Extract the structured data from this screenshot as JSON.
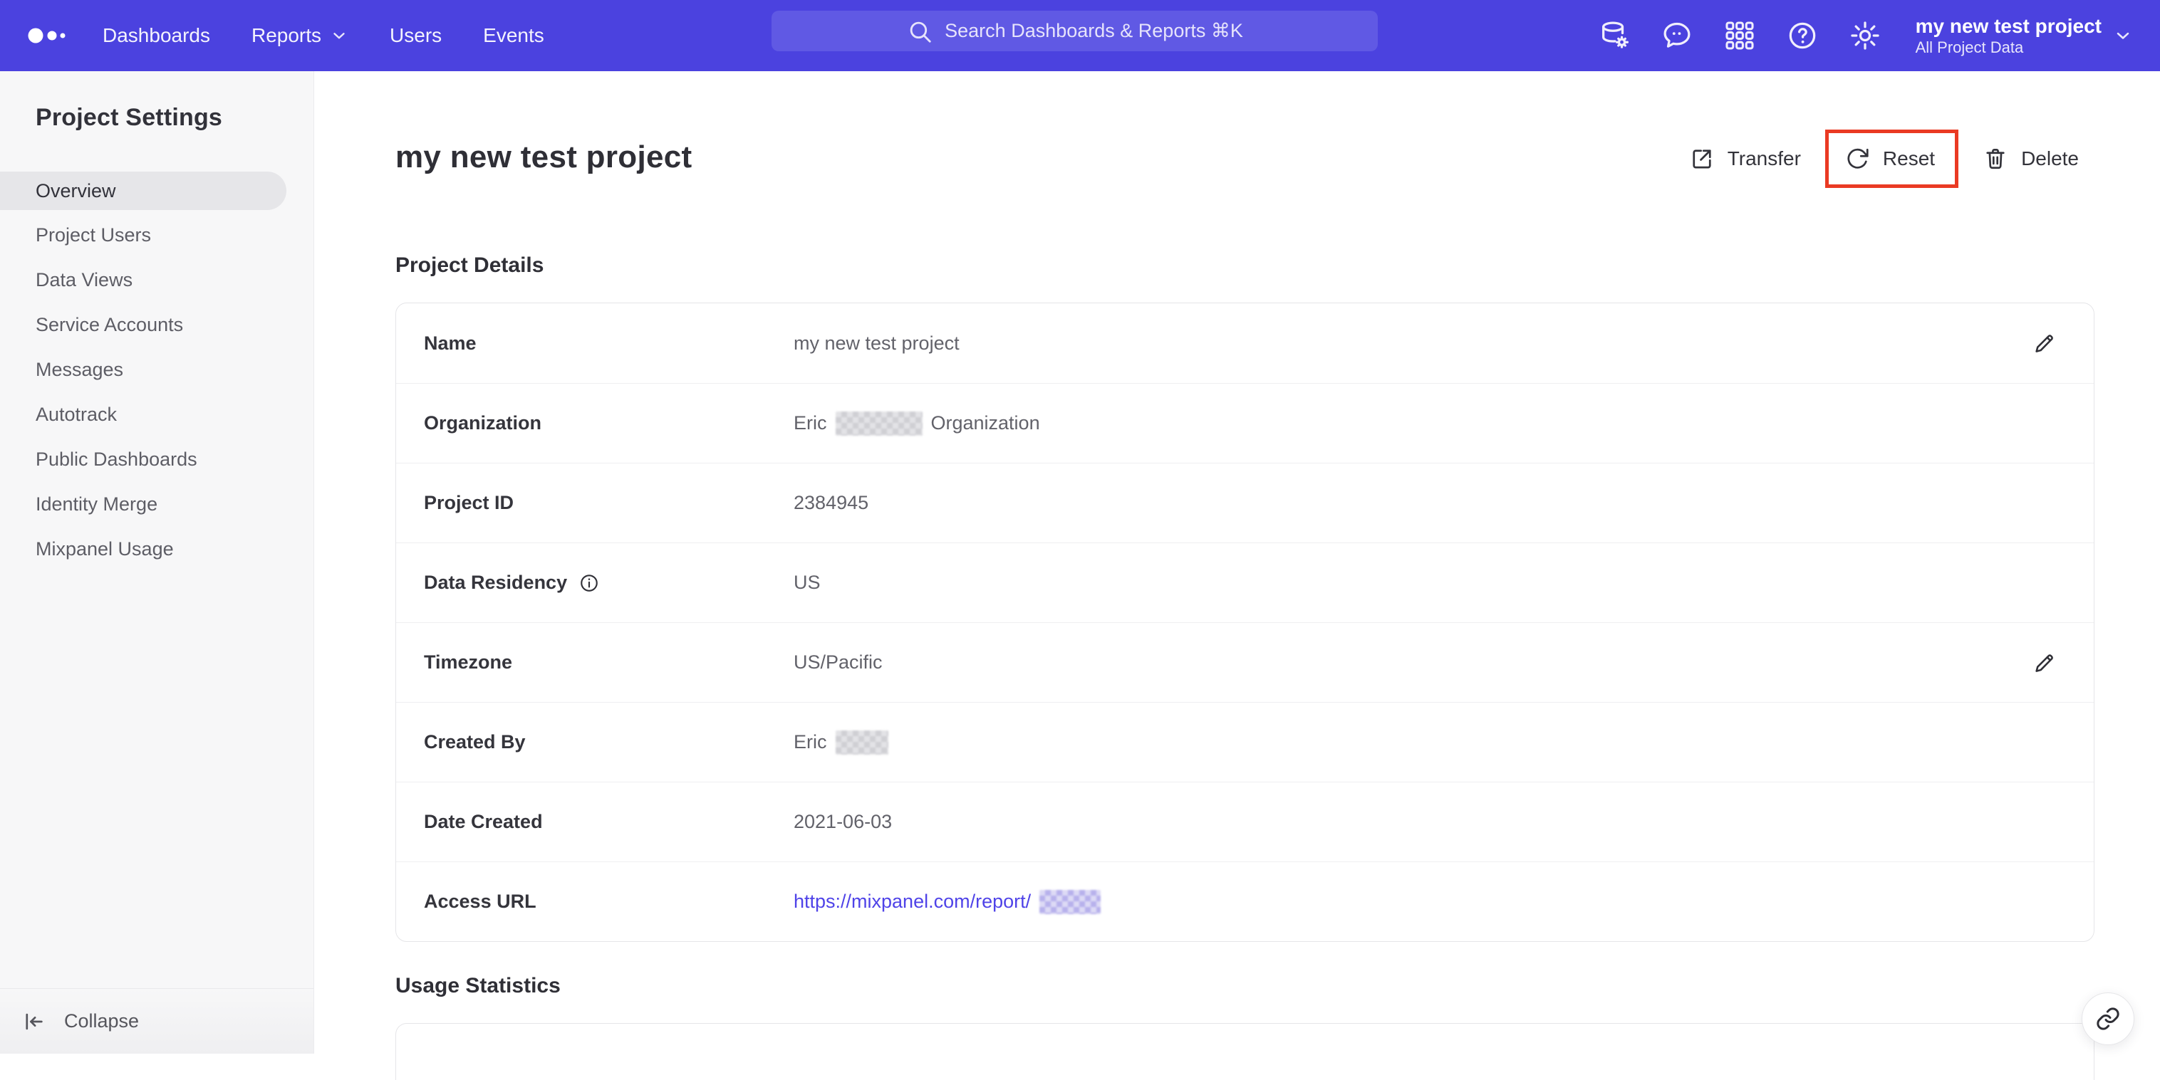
{
  "topnav": {
    "logo_icon": "mixpanel-logo-dots",
    "items": [
      {
        "label": "Dashboards",
        "has_chevron": false
      },
      {
        "label": "Reports",
        "has_chevron": true
      },
      {
        "label": "Users",
        "has_chevron": false
      },
      {
        "label": "Events",
        "has_chevron": false
      }
    ],
    "search": {
      "placeholder": "Search Dashboards & Reports ⌘K"
    },
    "icon_buttons": [
      "data-management-icon",
      "messages-icon",
      "apps-grid-icon",
      "help-icon",
      "settings-gear-icon"
    ],
    "project_switcher": {
      "project_name": "my new test project",
      "scope": "All Project Data"
    }
  },
  "sidebar": {
    "title": "Project Settings",
    "items": [
      {
        "label": "Overview",
        "active": true
      },
      {
        "label": "Project Users",
        "active": false
      },
      {
        "label": "Data Views",
        "active": false
      },
      {
        "label": "Service Accounts",
        "active": false
      },
      {
        "label": "Messages",
        "active": false
      },
      {
        "label": "Autotrack",
        "active": false
      },
      {
        "label": "Public Dashboards",
        "active": false
      },
      {
        "label": "Identity Merge",
        "active": false
      },
      {
        "label": "Mixpanel Usage",
        "active": false
      }
    ],
    "collapse_label": "Collapse"
  },
  "main": {
    "page_title": "my new test project",
    "actions": {
      "transfer_label": "Transfer",
      "reset_label": "Reset",
      "delete_label": "Delete"
    },
    "details_heading": "Project Details",
    "details_rows": [
      {
        "label": "Name",
        "value": "my new test project",
        "editable": true
      },
      {
        "label": "Organization",
        "value_prefix": "Eric",
        "value_suffix": "Organization",
        "redacted": true
      },
      {
        "label": "Project ID",
        "value": "2384945"
      },
      {
        "label": "Data Residency",
        "value": "US",
        "has_info_icon": true
      },
      {
        "label": "Timezone",
        "value": "US/Pacific",
        "editable": true
      },
      {
        "label": "Created By",
        "value_prefix": "Eric",
        "redacted": true
      },
      {
        "label": "Date Created",
        "value": "2021-06-03"
      },
      {
        "label": "Access URL",
        "link_prefix": "https://mixpanel.com/report/",
        "redacted": true
      }
    ],
    "usage_heading": "Usage Statistics"
  },
  "annotation": {
    "highlighted_action": "Reset",
    "color": "#ea3a23"
  },
  "colors": {
    "nav_bg": "#4b42df",
    "search_bg": "#6059e4",
    "sidebar_bg": "#f7f7f8",
    "active_item_bg": "#e6e6e9",
    "link": "#4f43e8",
    "text_dark": "#32323a",
    "text_gray": "#62626a",
    "annotation_red": "#ea3a23"
  }
}
